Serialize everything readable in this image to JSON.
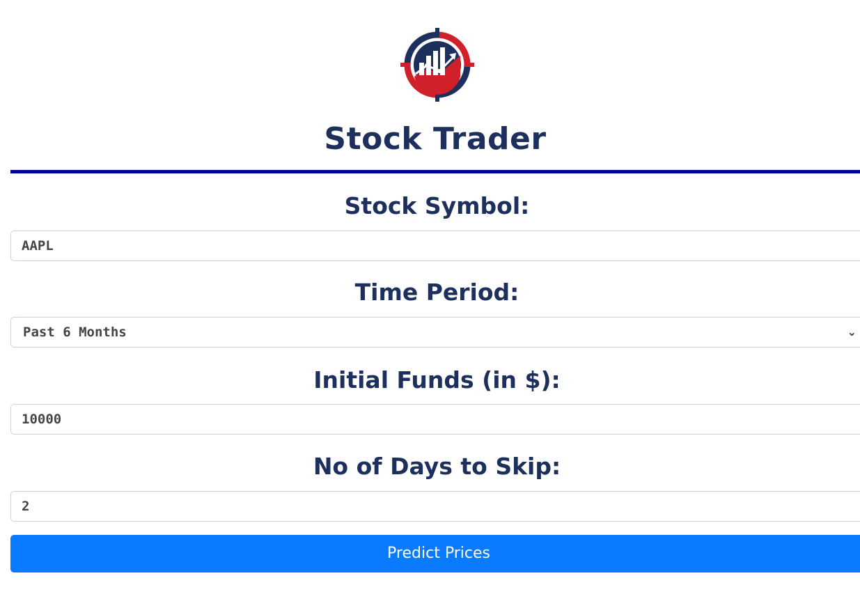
{
  "app": {
    "title": "Stock Trader",
    "logo_icon": "stock-chart-target-logo"
  },
  "form": {
    "symbol": {
      "label": "Stock Symbol:",
      "value": "AAPL"
    },
    "period": {
      "label": "Time Period:",
      "selected": "Past 6 Months"
    },
    "funds": {
      "label": "Initial Funds (in $):",
      "value": "10000"
    },
    "skip": {
      "label": "No of Days to Skip:",
      "value": "2"
    },
    "submit_label": "Predict Prices"
  },
  "colors": {
    "title": "#1d2f5c",
    "rule": "#0000a0",
    "button": "#0a7bff",
    "logo_red": "#d0202a",
    "logo_navy": "#1d2f5c"
  }
}
